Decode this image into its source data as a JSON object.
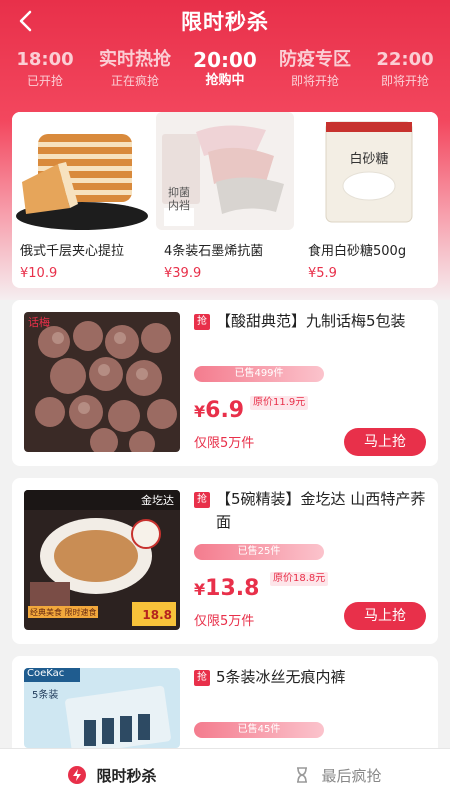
{
  "header": {
    "back_icon": "chevron-left-icon",
    "title": "限时秒杀"
  },
  "time_slots": [
    {
      "time": "18:00",
      "status": "已开抢"
    },
    {
      "time": "实时热抢",
      "status": "正在疯抢"
    },
    {
      "time": "20:00",
      "status": "抢购中"
    },
    {
      "time": "防疫专区",
      "status": "即将开抢"
    },
    {
      "time": "22:00",
      "status": "即将开抢"
    }
  ],
  "featured": [
    {
      "name": "俄式千层夹心提拉",
      "price": "¥10.9"
    },
    {
      "name": "4条装石墨烯抗菌",
      "price": "¥39.9",
      "image_text": "抑菌内裆"
    },
    {
      "name": "食用白砂糖500g",
      "price": "¥5.9",
      "image_text": "白砂糖"
    }
  ],
  "products": [
    {
      "badge": "抢",
      "name": "【酸甜典范】九制话梅5包装",
      "sold": "已售499件",
      "currency": "¥",
      "price": "6.9",
      "original": "原价11.9元",
      "limit": "仅限5万件",
      "buy": "马上抢",
      "image_text": "话梅"
    },
    {
      "badge": "抢",
      "name": "【5碗精装】金圪达 山西特产荞面",
      "sold": "已售25件",
      "currency": "¥",
      "price": "13.8",
      "original": "原价18.8元",
      "limit": "仅限5万件",
      "buy": "马上抢",
      "image_text_brand": "金圪达",
      "image_text_price": "18.8",
      "image_text_badge": "经典美食 限时速食"
    },
    {
      "badge": "抢",
      "name": "5条装冰丝无痕内裤",
      "sold": "已售45件",
      "image_text_brand": "CoeKac",
      "image_text_count": "5条装"
    }
  ],
  "tabbar": [
    {
      "label": "限时秒杀",
      "icon": "flash-icon"
    },
    {
      "label": "最后疯抢",
      "icon": "hourglass-icon"
    }
  ],
  "colors": {
    "accent": "#e8304a",
    "header_top": "#e8304a"
  }
}
